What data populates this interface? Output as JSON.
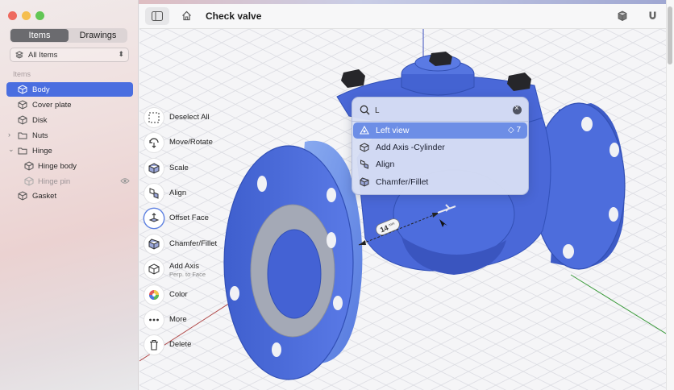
{
  "window": {
    "title": "Check valve"
  },
  "sidebar": {
    "tabs": [
      {
        "label": "Items",
        "active": true
      },
      {
        "label": "Drawings",
        "active": false
      }
    ],
    "filter": {
      "label": "All Items"
    },
    "section_label": "Items",
    "items": [
      {
        "label": "Body",
        "selected": true
      },
      {
        "label": "Cover plate"
      },
      {
        "label": "Disk"
      },
      {
        "label": "Nuts",
        "folder": true,
        "expanded": false
      },
      {
        "label": "Hinge",
        "folder": true,
        "expanded": true
      },
      {
        "label": "Hinge body",
        "child": true
      },
      {
        "label": "Hinge pin",
        "child": true,
        "hidden": true
      },
      {
        "label": "Gasket"
      }
    ]
  },
  "tools": [
    {
      "label": "Deselect All",
      "icon": "deselect-icon"
    },
    {
      "label": "Move/Rotate",
      "icon": "move-rotate-icon"
    },
    {
      "label": "Scale",
      "icon": "scale-icon"
    },
    {
      "label": "Align",
      "icon": "align-icon"
    },
    {
      "label": "Offset Face",
      "icon": "offset-face-icon"
    },
    {
      "label": "Chamfer/Fillet",
      "icon": "chamfer-icon"
    },
    {
      "label": "Add Axis",
      "sublabel": "Perp. to Face",
      "icon": "add-axis-icon"
    },
    {
      "label": "Color",
      "icon": "color-icon"
    },
    {
      "label": "More",
      "icon": "more-icon"
    },
    {
      "label": "Delete",
      "icon": "trash-icon"
    }
  ],
  "command_palette": {
    "search_value": "L",
    "search_placeholder": "Left view",
    "results": [
      {
        "label": "Left view",
        "shortcut": "◇ 7",
        "selected": true
      },
      {
        "label": "Add Axis -Cylinder"
      },
      {
        "label": "Align"
      },
      {
        "label": "Chamfer/Fillet"
      }
    ]
  },
  "viewport": {
    "dimension_label": "14",
    "dimension_unit": "mm"
  },
  "colors": {
    "accent": "#4a6ee0",
    "model": "#4a68d8",
    "model_dark": "#2e48a8",
    "face": "#9aa2b4"
  }
}
